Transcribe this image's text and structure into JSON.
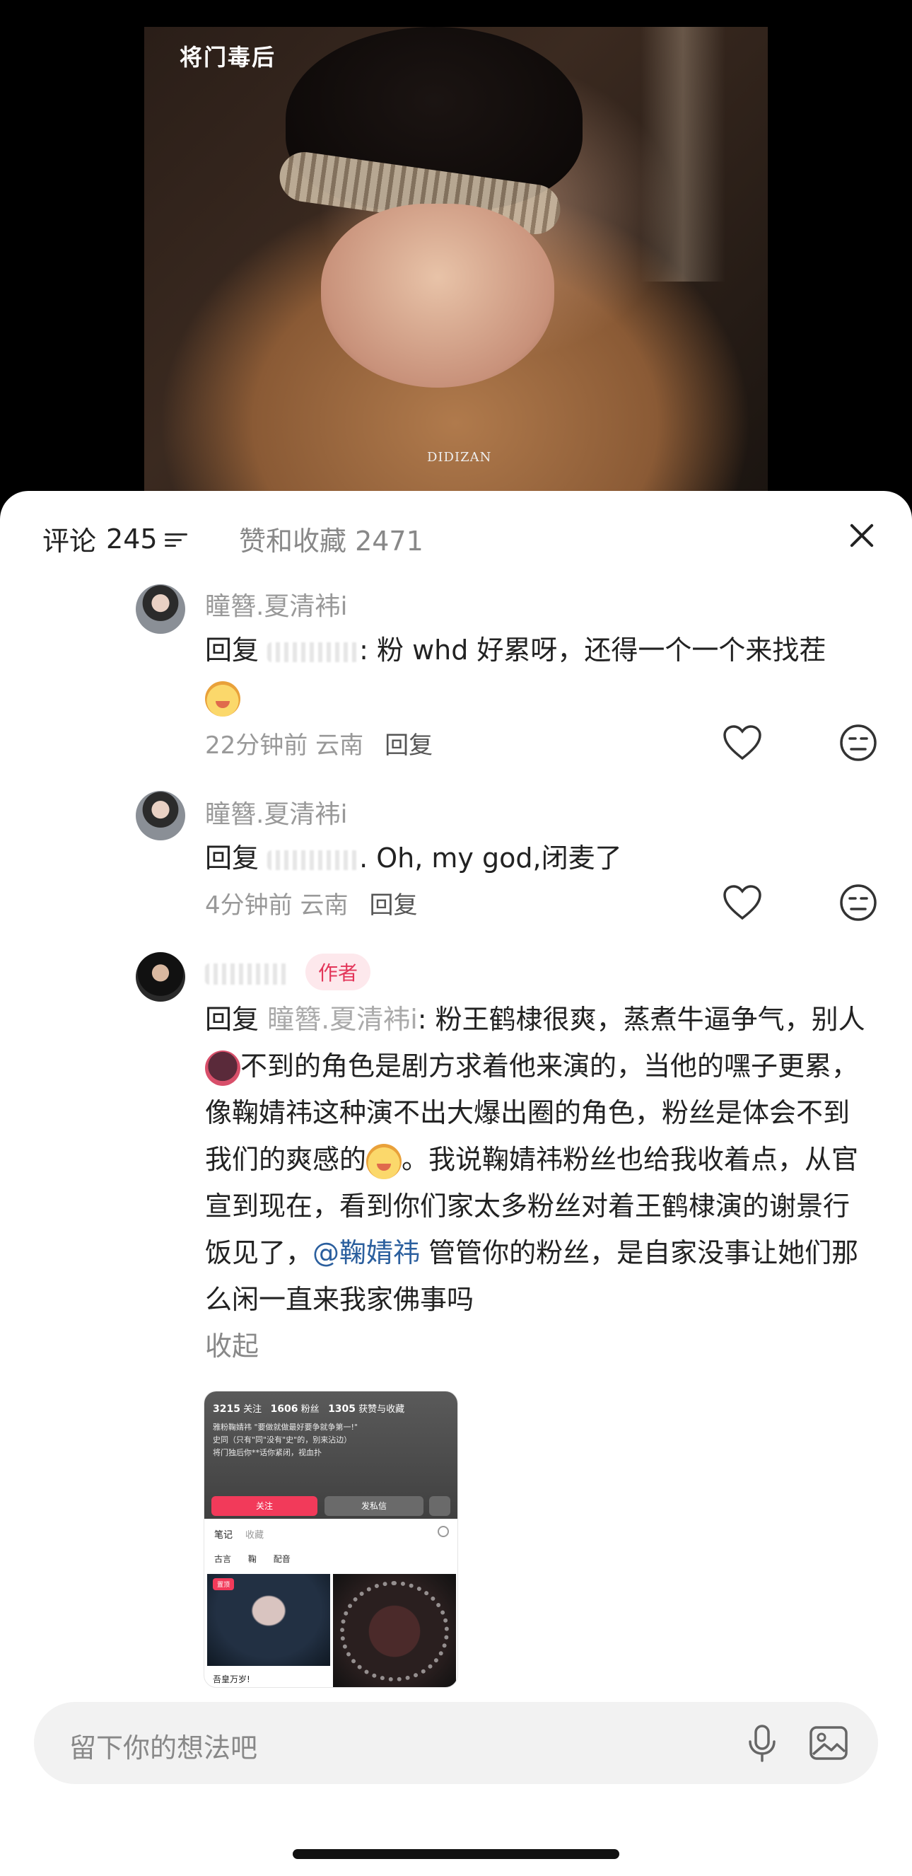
{
  "video": {
    "watermark": "将门毒后",
    "subtitle": "DIDIZAN"
  },
  "header": {
    "comments_label": "评论",
    "comments_count": "245",
    "likes_label": "赞和收藏 2471"
  },
  "comments": [
    {
      "username": "瞳簪.夏清袆i",
      "reply_prefix": "回复",
      "reply_tail": ": 粉 whd 好累呀，还得一个一个来找茬",
      "time_location": "22分钟前 云南",
      "reply_label": "回复"
    },
    {
      "username": "瞳簪.夏清袆i",
      "reply_prefix": "回复",
      "reply_tail": ". Oh, my god,闭麦了",
      "time_location": "4分钟前 云南",
      "reply_label": "回复"
    },
    {
      "username": "",
      "author_badge": "作者",
      "reply_prefix": "回复",
      "reply_target": "瞳簪.夏清袆i",
      "text_a": ": 粉王鹤棣很爽，蒸煮牛逼争气，别人",
      "text_b": "不到的角色是剧方求着他来演的，当他的嘿子更累，像鞠婧祎这种演不出大爆出圈的角色，粉丝是体会不到我们的爽感的",
      "text_c": "。我说鞠婧祎粉丝也给我收着点，从官宣到现在，看到你们家太多粉丝对着王鹤棣演的谢景行饭见了，",
      "mention": "@鞠婧祎",
      "text_d": " 管管你的粉丝，是自家没事让她们那么闲一直来我家佛事吗",
      "collapse": "收起"
    }
  ],
  "screenshot": {
    "stats": [
      {
        "num": "3215",
        "label": "关注"
      },
      {
        "num": "1606",
        "label": "粉丝"
      },
      {
        "num": "1305",
        "label": "获赞与收藏"
      }
    ],
    "bio_lines": [
      "雅粉鞠婧祎 \"要做就做最好要争就争第一!\"",
      "史同（只有\"同\"没有\"史\"的，别来沾边）",
      "将门独后你**话你紧闭，视血扑"
    ],
    "follow": "关注",
    "message": "发私信",
    "tab_notes": "笔记",
    "tab_collect": "收藏",
    "tags": [
      "古言",
      "鞠",
      "配音"
    ],
    "pin": "置顶",
    "caption": "吾皇万岁!"
  },
  "input": {
    "placeholder": "留下你的想法吧"
  }
}
